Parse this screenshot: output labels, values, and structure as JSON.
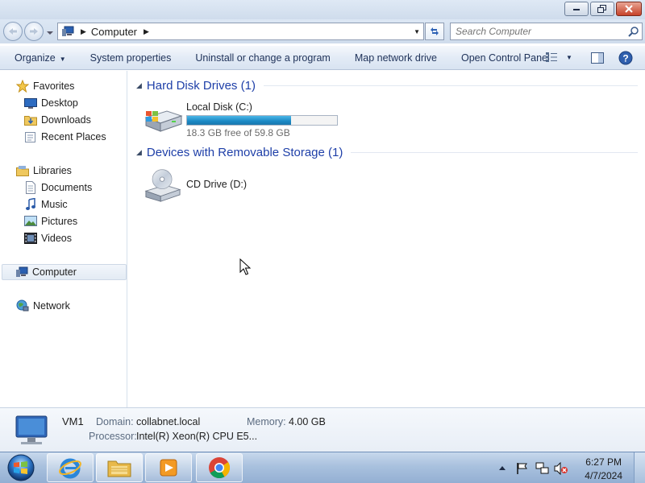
{
  "address": {
    "crumb": "Computer",
    "search_placeholder": "Search Computer"
  },
  "toolbar": {
    "organize": "Organize",
    "system_properties": "System properties",
    "uninstall": "Uninstall or change a program",
    "map_drive": "Map network drive",
    "control_panel": "Open Control Panel"
  },
  "nav": {
    "favorites": "Favorites",
    "desktop": "Desktop",
    "downloads": "Downloads",
    "recent": "Recent Places",
    "libraries": "Libraries",
    "documents": "Documents",
    "music": "Music",
    "pictures": "Pictures",
    "videos": "Videos",
    "computer": "Computer",
    "network": "Network"
  },
  "content": {
    "hdd_group": "Hard Disk Drives (1)",
    "removable_group": "Devices with Removable Storage (1)",
    "drive_c": {
      "name": "Local Disk (C:)",
      "free_text": "18.3 GB free of 59.8 GB",
      "used_fraction": 0.694
    },
    "drive_d": {
      "name": "CD Drive (D:)"
    }
  },
  "details": {
    "name": "VM1",
    "domain_label": "Domain:",
    "domain_value": "collabnet.local",
    "memory_label": "Memory:",
    "memory_value": "4.00 GB",
    "processor_label": "Processor:",
    "processor_value": "Intel(R) Xeon(R) CPU E5..."
  },
  "taskbar": {
    "time": "6:27 PM",
    "date": "4/7/2024"
  },
  "colors": {
    "accent_link": "#1e3fa8",
    "progress_fill": "#1b88c4"
  }
}
